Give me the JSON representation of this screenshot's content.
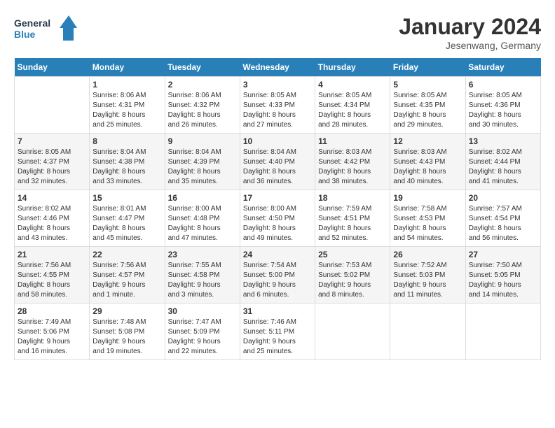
{
  "header": {
    "logo_line1": "General",
    "logo_line2": "Blue",
    "month_title": "January 2024",
    "location": "Jesenwang, Germany"
  },
  "days_of_week": [
    "Sunday",
    "Monday",
    "Tuesday",
    "Wednesday",
    "Thursday",
    "Friday",
    "Saturday"
  ],
  "weeks": [
    [
      {
        "day": "",
        "info": ""
      },
      {
        "day": "1",
        "info": "Sunrise: 8:06 AM\nSunset: 4:31 PM\nDaylight: 8 hours\nand 25 minutes."
      },
      {
        "day": "2",
        "info": "Sunrise: 8:06 AM\nSunset: 4:32 PM\nDaylight: 8 hours\nand 26 minutes."
      },
      {
        "day": "3",
        "info": "Sunrise: 8:05 AM\nSunset: 4:33 PM\nDaylight: 8 hours\nand 27 minutes."
      },
      {
        "day": "4",
        "info": "Sunrise: 8:05 AM\nSunset: 4:34 PM\nDaylight: 8 hours\nand 28 minutes."
      },
      {
        "day": "5",
        "info": "Sunrise: 8:05 AM\nSunset: 4:35 PM\nDaylight: 8 hours\nand 29 minutes."
      },
      {
        "day": "6",
        "info": "Sunrise: 8:05 AM\nSunset: 4:36 PM\nDaylight: 8 hours\nand 30 minutes."
      }
    ],
    [
      {
        "day": "7",
        "info": "Sunrise: 8:05 AM\nSunset: 4:37 PM\nDaylight: 8 hours\nand 32 minutes."
      },
      {
        "day": "8",
        "info": "Sunrise: 8:04 AM\nSunset: 4:38 PM\nDaylight: 8 hours\nand 33 minutes."
      },
      {
        "day": "9",
        "info": "Sunrise: 8:04 AM\nSunset: 4:39 PM\nDaylight: 8 hours\nand 35 minutes."
      },
      {
        "day": "10",
        "info": "Sunrise: 8:04 AM\nSunset: 4:40 PM\nDaylight: 8 hours\nand 36 minutes."
      },
      {
        "day": "11",
        "info": "Sunrise: 8:03 AM\nSunset: 4:42 PM\nDaylight: 8 hours\nand 38 minutes."
      },
      {
        "day": "12",
        "info": "Sunrise: 8:03 AM\nSunset: 4:43 PM\nDaylight: 8 hours\nand 40 minutes."
      },
      {
        "day": "13",
        "info": "Sunrise: 8:02 AM\nSunset: 4:44 PM\nDaylight: 8 hours\nand 41 minutes."
      }
    ],
    [
      {
        "day": "14",
        "info": "Sunrise: 8:02 AM\nSunset: 4:46 PM\nDaylight: 8 hours\nand 43 minutes."
      },
      {
        "day": "15",
        "info": "Sunrise: 8:01 AM\nSunset: 4:47 PM\nDaylight: 8 hours\nand 45 minutes."
      },
      {
        "day": "16",
        "info": "Sunrise: 8:00 AM\nSunset: 4:48 PM\nDaylight: 8 hours\nand 47 minutes."
      },
      {
        "day": "17",
        "info": "Sunrise: 8:00 AM\nSunset: 4:50 PM\nDaylight: 8 hours\nand 49 minutes."
      },
      {
        "day": "18",
        "info": "Sunrise: 7:59 AM\nSunset: 4:51 PM\nDaylight: 8 hours\nand 52 minutes."
      },
      {
        "day": "19",
        "info": "Sunrise: 7:58 AM\nSunset: 4:53 PM\nDaylight: 8 hours\nand 54 minutes."
      },
      {
        "day": "20",
        "info": "Sunrise: 7:57 AM\nSunset: 4:54 PM\nDaylight: 8 hours\nand 56 minutes."
      }
    ],
    [
      {
        "day": "21",
        "info": "Sunrise: 7:56 AM\nSunset: 4:55 PM\nDaylight: 8 hours\nand 58 minutes."
      },
      {
        "day": "22",
        "info": "Sunrise: 7:56 AM\nSunset: 4:57 PM\nDaylight: 9 hours\nand 1 minute."
      },
      {
        "day": "23",
        "info": "Sunrise: 7:55 AM\nSunset: 4:58 PM\nDaylight: 9 hours\nand 3 minutes."
      },
      {
        "day": "24",
        "info": "Sunrise: 7:54 AM\nSunset: 5:00 PM\nDaylight: 9 hours\nand 6 minutes."
      },
      {
        "day": "25",
        "info": "Sunrise: 7:53 AM\nSunset: 5:02 PM\nDaylight: 9 hours\nand 8 minutes."
      },
      {
        "day": "26",
        "info": "Sunrise: 7:52 AM\nSunset: 5:03 PM\nDaylight: 9 hours\nand 11 minutes."
      },
      {
        "day": "27",
        "info": "Sunrise: 7:50 AM\nSunset: 5:05 PM\nDaylight: 9 hours\nand 14 minutes."
      }
    ],
    [
      {
        "day": "28",
        "info": "Sunrise: 7:49 AM\nSunset: 5:06 PM\nDaylight: 9 hours\nand 16 minutes."
      },
      {
        "day": "29",
        "info": "Sunrise: 7:48 AM\nSunset: 5:08 PM\nDaylight: 9 hours\nand 19 minutes."
      },
      {
        "day": "30",
        "info": "Sunrise: 7:47 AM\nSunset: 5:09 PM\nDaylight: 9 hours\nand 22 minutes."
      },
      {
        "day": "31",
        "info": "Sunrise: 7:46 AM\nSunset: 5:11 PM\nDaylight: 9 hours\nand 25 minutes."
      },
      {
        "day": "",
        "info": ""
      },
      {
        "day": "",
        "info": ""
      },
      {
        "day": "",
        "info": ""
      }
    ]
  ]
}
